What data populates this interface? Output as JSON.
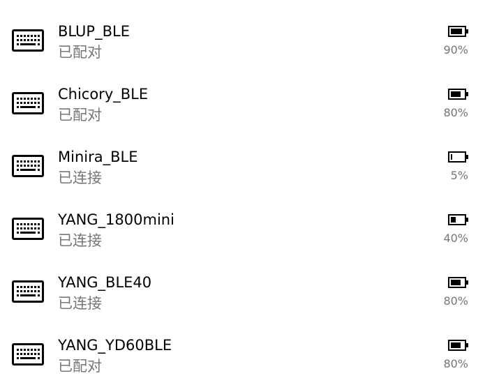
{
  "devices": [
    {
      "name": "BLUP_BLE",
      "status": "已配对",
      "battery_text": "90%",
      "battery_level": 0.9,
      "icon": "keyboard-icon"
    },
    {
      "name": "Chicory_BLE",
      "status": "已配对",
      "battery_text": "80%",
      "battery_level": 0.8,
      "icon": "keyboard-icon"
    },
    {
      "name": "Minira_BLE",
      "status": "已连接",
      "battery_text": "5%",
      "battery_level": 0.05,
      "icon": "keyboard-icon"
    },
    {
      "name": "YANG_1800mini",
      "status": "已连接",
      "battery_text": "40%",
      "battery_level": 0.4,
      "icon": "keyboard-icon"
    },
    {
      "name": "YANG_BLE40",
      "status": "已连接",
      "battery_text": "80%",
      "battery_level": 0.8,
      "icon": "keyboard-icon"
    },
    {
      "name": "YANG_YD60BLE",
      "status": "已配对",
      "battery_text": "80%",
      "battery_level": 0.8,
      "icon": "keyboard-icon"
    }
  ],
  "colors": {
    "primary_text": "#000000",
    "secondary_text": "#767676",
    "background": "#ffffff"
  }
}
